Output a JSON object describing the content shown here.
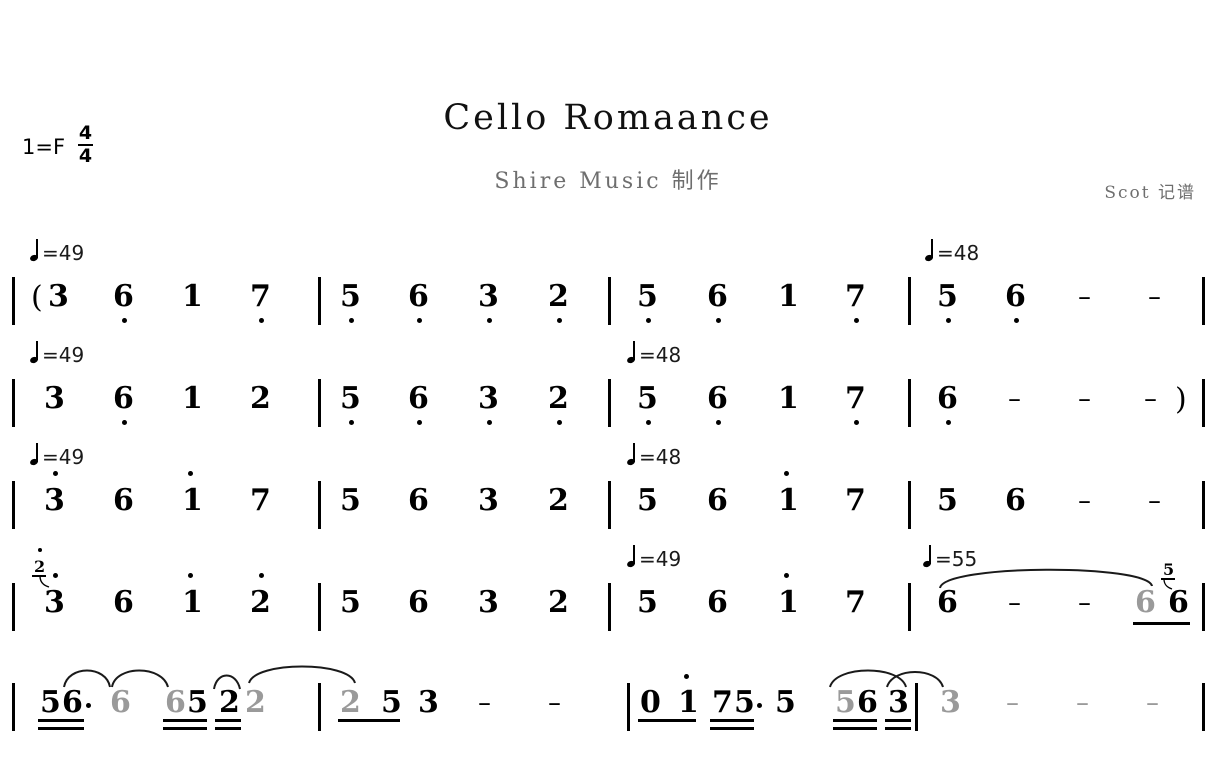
{
  "header": {
    "key_signature": "1=F",
    "time_sig_numerator": "4",
    "time_sig_denominator": "4",
    "title": "Cello Romaance",
    "subtitle": "Shire Music  制作",
    "credit": "Scot  记谱"
  },
  "colors": {
    "ink": "#000000",
    "muted": "#9a9a9a",
    "subtitle": "#6e6e6e",
    "background": "#ffffff"
  },
  "tempos": [
    {
      "id": "t1",
      "label": "=49"
    },
    {
      "id": "t2",
      "label": "=48"
    },
    {
      "id": "t3",
      "label": "=49"
    },
    {
      "id": "t4",
      "label": "=48"
    },
    {
      "id": "t5",
      "label": "=49"
    },
    {
      "id": "t6",
      "label": "=48"
    },
    {
      "id": "t7",
      "label": "=49"
    },
    {
      "id": "t8",
      "label": "=55"
    }
  ],
  "score": {
    "notation_type": "jianpu",
    "rows": [
      {
        "index": 1,
        "tempo_marks": [
          "=49",
          "=48"
        ],
        "measures": [
          {
            "notes": [
              {
                "text": "(",
                "kind": "paren"
              },
              {
                "text": "3",
                "octave": 0
              },
              {
                "text": "6",
                "octave": -1
              },
              {
                "text": "1",
                "octave": 0
              },
              {
                "text": "7",
                "octave": -1
              }
            ]
          },
          {
            "notes": [
              {
                "text": "5",
                "octave": -1
              },
              {
                "text": "6",
                "octave": -1
              },
              {
                "text": "3",
                "octave": -1
              },
              {
                "text": "2",
                "octave": -1
              }
            ]
          },
          {
            "notes": [
              {
                "text": "5",
                "octave": -1
              },
              {
                "text": "6",
                "octave": -1
              },
              {
                "text": "1",
                "octave": 0
              },
              {
                "text": "7",
                "octave": -1
              }
            ]
          },
          {
            "notes": [
              {
                "text": "5",
                "octave": -1
              },
              {
                "text": "6",
                "octave": -1
              },
              {
                "text": "–",
                "kind": "dash"
              },
              {
                "text": "–",
                "kind": "dash"
              }
            ]
          }
        ]
      },
      {
        "index": 2,
        "tempo_marks": [
          "=49",
          "=48"
        ],
        "measures": [
          {
            "notes": [
              {
                "text": "3",
                "octave": 0
              },
              {
                "text": "6",
                "octave": -1
              },
              {
                "text": "1",
                "octave": 0
              },
              {
                "text": "2",
                "octave": 0
              }
            ]
          },
          {
            "notes": [
              {
                "text": "5",
                "octave": -1
              },
              {
                "text": "6",
                "octave": -1
              },
              {
                "text": "3",
                "octave": -1
              },
              {
                "text": "2",
                "octave": -1
              }
            ]
          },
          {
            "notes": [
              {
                "text": "5",
                "octave": -1
              },
              {
                "text": "6",
                "octave": -1
              },
              {
                "text": "1",
                "octave": 0
              },
              {
                "text": "7",
                "octave": -1
              }
            ]
          },
          {
            "notes": [
              {
                "text": "6",
                "octave": -1
              },
              {
                "text": "–",
                "kind": "dash"
              },
              {
                "text": "–",
                "kind": "dash"
              },
              {
                "text": "–",
                "kind": "dash"
              },
              {
                "text": ")",
                "kind": "paren"
              }
            ]
          }
        ]
      },
      {
        "index": 3,
        "tempo_marks": [
          "=49",
          "=48"
        ],
        "measures": [
          {
            "notes": [
              {
                "text": "3",
                "octave": 1
              },
              {
                "text": "6",
                "octave": 0
              },
              {
                "text": "1",
                "octave": 1
              },
              {
                "text": "7",
                "octave": 0
              }
            ]
          },
          {
            "notes": [
              {
                "text": "5",
                "octave": 0
              },
              {
                "text": "6",
                "octave": 0
              },
              {
                "text": "3",
                "octave": 0
              },
              {
                "text": "2",
                "octave": 0
              }
            ]
          },
          {
            "notes": [
              {
                "text": "5",
                "octave": 0
              },
              {
                "text": "6",
                "octave": 0
              },
              {
                "text": "1",
                "octave": 1
              },
              {
                "text": "7",
                "octave": 0
              }
            ]
          },
          {
            "notes": [
              {
                "text": "5",
                "octave": 0
              },
              {
                "text": "6",
                "octave": 0
              },
              {
                "text": "–",
                "kind": "dash"
              },
              {
                "text": "–",
                "kind": "dash"
              }
            ]
          }
        ]
      },
      {
        "index": 4,
        "tempo_marks": [
          "=49",
          "=55"
        ],
        "measures": [
          {
            "notes": [
              {
                "text": "3",
                "octave": 1,
                "grace": "2",
                "grace_octave": 1
              },
              {
                "text": "6",
                "octave": 0
              },
              {
                "text": "1",
                "octave": 1
              },
              {
                "text": "2",
                "octave": 1
              }
            ]
          },
          {
            "notes": [
              {
                "text": "5",
                "octave": 0
              },
              {
                "text": "6",
                "octave": 0
              },
              {
                "text": "3",
                "octave": 0
              },
              {
                "text": "2",
                "octave": 0
              }
            ]
          },
          {
            "notes": [
              {
                "text": "5",
                "octave": 0
              },
              {
                "text": "6",
                "octave": 0
              },
              {
                "text": "1",
                "octave": 1
              },
              {
                "text": "7",
                "octave": 0
              }
            ]
          },
          {
            "notes": [
              {
                "text": "6",
                "octave": 0
              },
              {
                "text": "–",
                "kind": "dash"
              },
              {
                "text": "–",
                "kind": "dash"
              },
              {
                "text": "6",
                "octave": 0,
                "beam": 1,
                "muted": true
              },
              {
                "text": "6",
                "octave": 0,
                "beam": 1,
                "grace": "5"
              }
            ],
            "slur": true
          }
        ]
      },
      {
        "index": 5,
        "tempo_marks": [],
        "measures": [
          {
            "notes": [
              {
                "text": "5",
                "octave": 0,
                "beam": 2
              },
              {
                "text": "6",
                "octave": 0,
                "beam": 2,
                "aug_dot": true
              },
              {
                "text": "6",
                "octave": 0,
                "muted": true
              },
              {
                "text": "6",
                "octave": 0,
                "beam": 2,
                "muted": true
              },
              {
                "text": "5",
                "octave": 0,
                "beam": 2
              },
              {
                "text": "2",
                "octave": 0,
                "beam": 2
              },
              {
                "text": "2",
                "octave": 0,
                "muted": true
              }
            ]
          },
          {
            "notes": [
              {
                "text": "2",
                "octave": 0,
                "beam": 1,
                "muted": true
              },
              {
                "text": "5",
                "octave": 0,
                "beam": 1
              },
              {
                "text": "3",
                "octave": 0
              },
              {
                "text": "–",
                "kind": "dash"
              },
              {
                "text": "–",
                "kind": "dash"
              }
            ]
          },
          {
            "notes": [
              {
                "text": "0",
                "octave": 0,
                "beam": 1
              },
              {
                "text": "1",
                "octave": 1,
                "beam": 1
              },
              {
                "text": "7",
                "octave": 0,
                "beam": 2
              },
              {
                "text": "5",
                "octave": 0,
                "beam": 2,
                "aug_dot": true
              },
              {
                "text": "5",
                "octave": 0
              },
              {
                "text": "5",
                "octave": 0,
                "beam": 2,
                "muted": true
              },
              {
                "text": "6",
                "octave": 0,
                "beam": 2
              },
              {
                "text": "3",
                "octave": 0,
                "beam": 2
              }
            ]
          },
          {
            "notes": [
              {
                "text": "3",
                "octave": 0,
                "muted": true
              },
              {
                "text": "–",
                "kind": "dash",
                "muted": true
              },
              {
                "text": "–",
                "kind": "dash",
                "muted": true
              },
              {
                "text": "–",
                "kind": "dash",
                "muted": true
              }
            ]
          }
        ]
      }
    ]
  }
}
